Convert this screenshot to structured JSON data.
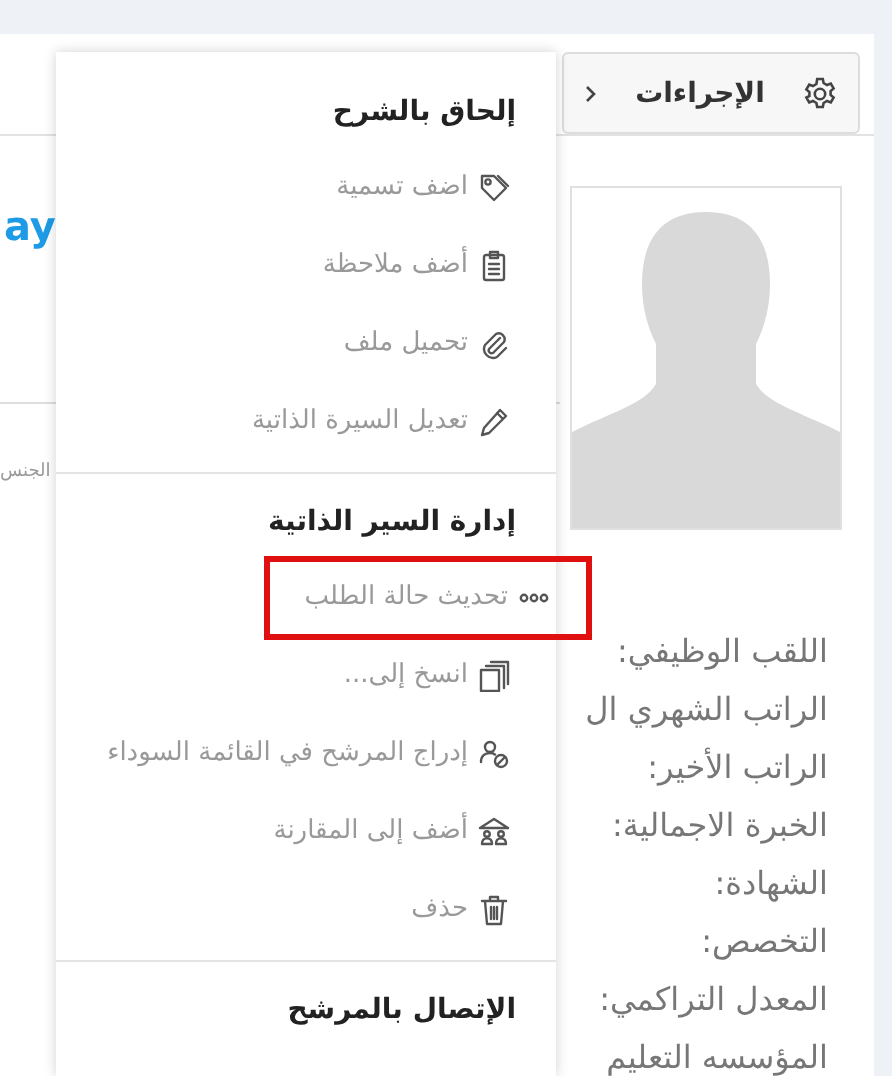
{
  "header": {
    "actions_button": {
      "label": "الإجراءات"
    }
  },
  "profile": {
    "name": "ay",
    "side_label": "الجنس",
    "fields": [
      "اللقب الوظيفي:",
      "الراتب الشهري ال",
      "الراتب الأخير:",
      "الخبرة الاجمالية:",
      "الشهادة:",
      "التخصص:",
      "المعدل التراكمي:",
      "المؤسسه التعليم"
    ]
  },
  "menu": {
    "sections": [
      {
        "title": "إلحاق بالشرح",
        "items": [
          {
            "label": "اضف تسمية",
            "kind": "tag",
            "highlighted": false
          },
          {
            "label": "أضف ملاحظة",
            "kind": "clipboard",
            "highlighted": false
          },
          {
            "label": "تحميل ملف",
            "kind": "paperclip",
            "highlighted": false
          },
          {
            "label": "تعديل السيرة الذاتية",
            "kind": "pencil",
            "highlighted": false
          }
        ]
      },
      {
        "title": "إدارة السير الذاتية",
        "items": [
          {
            "label": "تحديث حالة الطلب",
            "kind": "dots",
            "highlighted": true
          },
          {
            "label": "انسخ إلى...",
            "kind": "copy",
            "highlighted": false
          },
          {
            "label": "إدراج المرشح في القائمة السوداء",
            "kind": "block-user",
            "highlighted": false
          },
          {
            "label": "أضف إلى المقارنة",
            "kind": "compare",
            "highlighted": false
          },
          {
            "label": "حذف",
            "kind": "trash",
            "highlighted": false
          }
        ]
      },
      {
        "title": "الإتصال بالمرشح"
      }
    ]
  }
}
